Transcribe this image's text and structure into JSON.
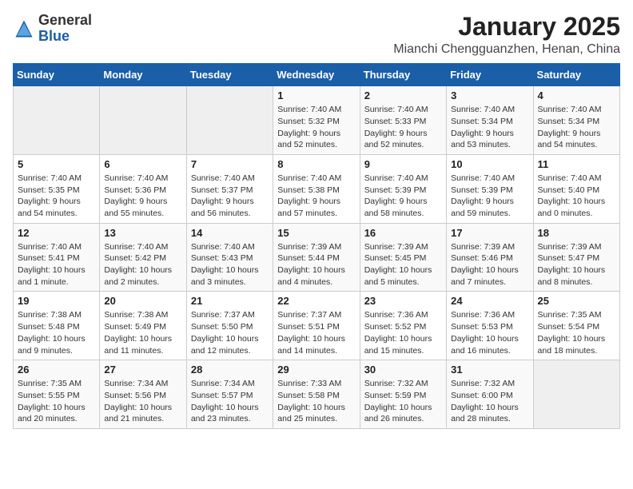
{
  "header": {
    "logo_general": "General",
    "logo_blue": "Blue",
    "title": "January 2025",
    "subtitle": "Mianchi Chengguanzhen, Henan, China"
  },
  "days_of_week": [
    "Sunday",
    "Monday",
    "Tuesday",
    "Wednesday",
    "Thursday",
    "Friday",
    "Saturday"
  ],
  "weeks": [
    [
      {
        "day": "",
        "info": ""
      },
      {
        "day": "",
        "info": ""
      },
      {
        "day": "",
        "info": ""
      },
      {
        "day": "1",
        "info": "Sunrise: 7:40 AM\nSunset: 5:32 PM\nDaylight: 9 hours\nand 52 minutes."
      },
      {
        "day": "2",
        "info": "Sunrise: 7:40 AM\nSunset: 5:33 PM\nDaylight: 9 hours\nand 52 minutes."
      },
      {
        "day": "3",
        "info": "Sunrise: 7:40 AM\nSunset: 5:34 PM\nDaylight: 9 hours\nand 53 minutes."
      },
      {
        "day": "4",
        "info": "Sunrise: 7:40 AM\nSunset: 5:34 PM\nDaylight: 9 hours\nand 54 minutes."
      }
    ],
    [
      {
        "day": "5",
        "info": "Sunrise: 7:40 AM\nSunset: 5:35 PM\nDaylight: 9 hours\nand 54 minutes."
      },
      {
        "day": "6",
        "info": "Sunrise: 7:40 AM\nSunset: 5:36 PM\nDaylight: 9 hours\nand 55 minutes."
      },
      {
        "day": "7",
        "info": "Sunrise: 7:40 AM\nSunset: 5:37 PM\nDaylight: 9 hours\nand 56 minutes."
      },
      {
        "day": "8",
        "info": "Sunrise: 7:40 AM\nSunset: 5:38 PM\nDaylight: 9 hours\nand 57 minutes."
      },
      {
        "day": "9",
        "info": "Sunrise: 7:40 AM\nSunset: 5:39 PM\nDaylight: 9 hours\nand 58 minutes."
      },
      {
        "day": "10",
        "info": "Sunrise: 7:40 AM\nSunset: 5:39 PM\nDaylight: 9 hours\nand 59 minutes."
      },
      {
        "day": "11",
        "info": "Sunrise: 7:40 AM\nSunset: 5:40 PM\nDaylight: 10 hours\nand 0 minutes."
      }
    ],
    [
      {
        "day": "12",
        "info": "Sunrise: 7:40 AM\nSunset: 5:41 PM\nDaylight: 10 hours\nand 1 minute."
      },
      {
        "day": "13",
        "info": "Sunrise: 7:40 AM\nSunset: 5:42 PM\nDaylight: 10 hours\nand 2 minutes."
      },
      {
        "day": "14",
        "info": "Sunrise: 7:40 AM\nSunset: 5:43 PM\nDaylight: 10 hours\nand 3 minutes."
      },
      {
        "day": "15",
        "info": "Sunrise: 7:39 AM\nSunset: 5:44 PM\nDaylight: 10 hours\nand 4 minutes."
      },
      {
        "day": "16",
        "info": "Sunrise: 7:39 AM\nSunset: 5:45 PM\nDaylight: 10 hours\nand 5 minutes."
      },
      {
        "day": "17",
        "info": "Sunrise: 7:39 AM\nSunset: 5:46 PM\nDaylight: 10 hours\nand 7 minutes."
      },
      {
        "day": "18",
        "info": "Sunrise: 7:39 AM\nSunset: 5:47 PM\nDaylight: 10 hours\nand 8 minutes."
      }
    ],
    [
      {
        "day": "19",
        "info": "Sunrise: 7:38 AM\nSunset: 5:48 PM\nDaylight: 10 hours\nand 9 minutes."
      },
      {
        "day": "20",
        "info": "Sunrise: 7:38 AM\nSunset: 5:49 PM\nDaylight: 10 hours\nand 11 minutes."
      },
      {
        "day": "21",
        "info": "Sunrise: 7:37 AM\nSunset: 5:50 PM\nDaylight: 10 hours\nand 12 minutes."
      },
      {
        "day": "22",
        "info": "Sunrise: 7:37 AM\nSunset: 5:51 PM\nDaylight: 10 hours\nand 14 minutes."
      },
      {
        "day": "23",
        "info": "Sunrise: 7:36 AM\nSunset: 5:52 PM\nDaylight: 10 hours\nand 15 minutes."
      },
      {
        "day": "24",
        "info": "Sunrise: 7:36 AM\nSunset: 5:53 PM\nDaylight: 10 hours\nand 16 minutes."
      },
      {
        "day": "25",
        "info": "Sunrise: 7:35 AM\nSunset: 5:54 PM\nDaylight: 10 hours\nand 18 minutes."
      }
    ],
    [
      {
        "day": "26",
        "info": "Sunrise: 7:35 AM\nSunset: 5:55 PM\nDaylight: 10 hours\nand 20 minutes."
      },
      {
        "day": "27",
        "info": "Sunrise: 7:34 AM\nSunset: 5:56 PM\nDaylight: 10 hours\nand 21 minutes."
      },
      {
        "day": "28",
        "info": "Sunrise: 7:34 AM\nSunset: 5:57 PM\nDaylight: 10 hours\nand 23 minutes."
      },
      {
        "day": "29",
        "info": "Sunrise: 7:33 AM\nSunset: 5:58 PM\nDaylight: 10 hours\nand 25 minutes."
      },
      {
        "day": "30",
        "info": "Sunrise: 7:32 AM\nSunset: 5:59 PM\nDaylight: 10 hours\nand 26 minutes."
      },
      {
        "day": "31",
        "info": "Sunrise: 7:32 AM\nSunset: 6:00 PM\nDaylight: 10 hours\nand 28 minutes."
      },
      {
        "day": "",
        "info": ""
      }
    ]
  ]
}
